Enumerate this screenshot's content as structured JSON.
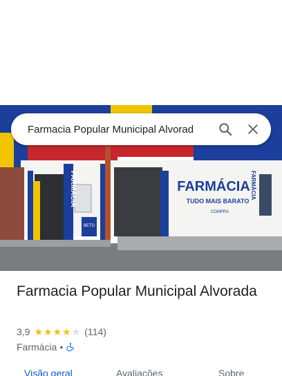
{
  "search": {
    "query": "Farmacia Popular Municipal Alvorad"
  },
  "place": {
    "name": "Farmacia Popular Municipal Alvorada",
    "rating": "3,9",
    "rating_value": 3.9,
    "review_count": "(114)",
    "category": "Farmácia",
    "separator": "•"
  },
  "photo_signage": {
    "farmacia": "FARMÁCIA",
    "slogan": "TUDO MAIS BARATO",
    "compra": "COMPRA",
    "beto": "BETO",
    "vertical": "FARMÁCIA"
  },
  "tabs": [
    {
      "label": "Visão geral",
      "active": true
    },
    {
      "label": "Avaliações",
      "active": false
    },
    {
      "label": "Sobre",
      "active": false
    }
  ],
  "icons": {
    "search": "search-icon",
    "close": "close-icon",
    "star": "star-icon",
    "accessibility": "wheelchair-icon"
  },
  "colors": {
    "star": "#fbbc04",
    "active_tab": "#0b57d0",
    "accessibility": "#1a73e8"
  }
}
